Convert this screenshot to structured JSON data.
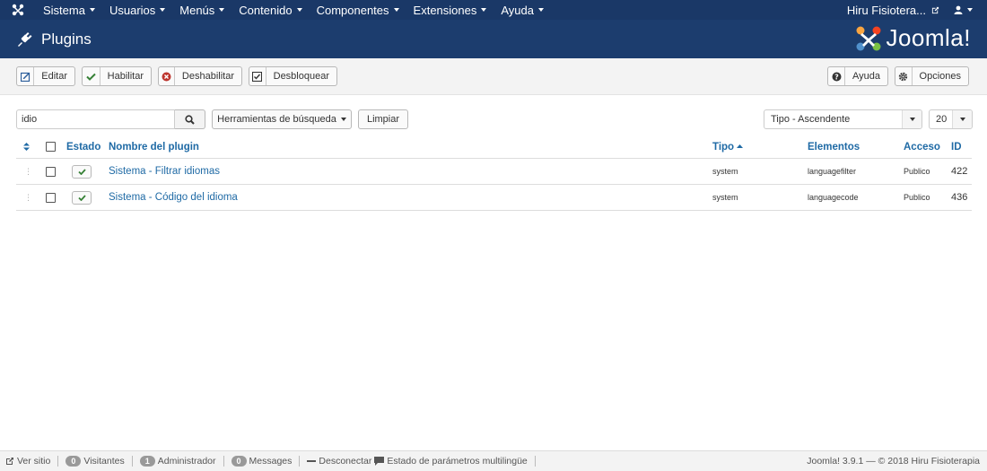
{
  "topnav": {
    "menu": [
      "Sistema",
      "Usuarios",
      "Menús",
      "Contenido",
      "Componentes",
      "Extensiones",
      "Ayuda"
    ],
    "user": "Hiru Fisiotera..."
  },
  "header": {
    "title": "Plugins",
    "brand": "Joomla!"
  },
  "toolbar": {
    "edit": "Editar",
    "enable": "Habilitar",
    "disable": "Deshabilitar",
    "unlock": "Desbloquear",
    "help": "Ayuda",
    "options": "Opciones"
  },
  "filters": {
    "search_value": "idio",
    "search_tools": "Herramientas de búsqueda",
    "clear": "Limpiar",
    "sort": "Tipo - Ascendente",
    "limit": "20"
  },
  "table": {
    "headers": {
      "status": "Estado",
      "name": "Nombre del plugin",
      "type": "Tipo",
      "element": "Elementos",
      "access": "Acceso",
      "id": "ID"
    },
    "rows": [
      {
        "name": "Sistema - Filtrar idiomas",
        "type": "system",
        "element": "languagefilter",
        "access": "Publico",
        "id": "422"
      },
      {
        "name": "Sistema - Código del idioma",
        "type": "system",
        "element": "languagecode",
        "access": "Publico",
        "id": "436"
      }
    ]
  },
  "footer": {
    "view_site": "Ver sitio",
    "visitors_count": "0",
    "visitors": "Visitantes",
    "admin_count": "1",
    "admin": "Administrador",
    "messages_count": "0",
    "messages": "Messages",
    "logout": "Desconectar",
    "multilang": "Estado de parámetros multilingüe",
    "copyright": "Joomla! 3.9.1  — © 2018 Hiru Fisioterapia"
  },
  "colors": {
    "nav": "#1a3867",
    "header": "#1c3d6e",
    "link": "#1f6aa5",
    "check": "#378137",
    "danger": "#bd362f"
  }
}
